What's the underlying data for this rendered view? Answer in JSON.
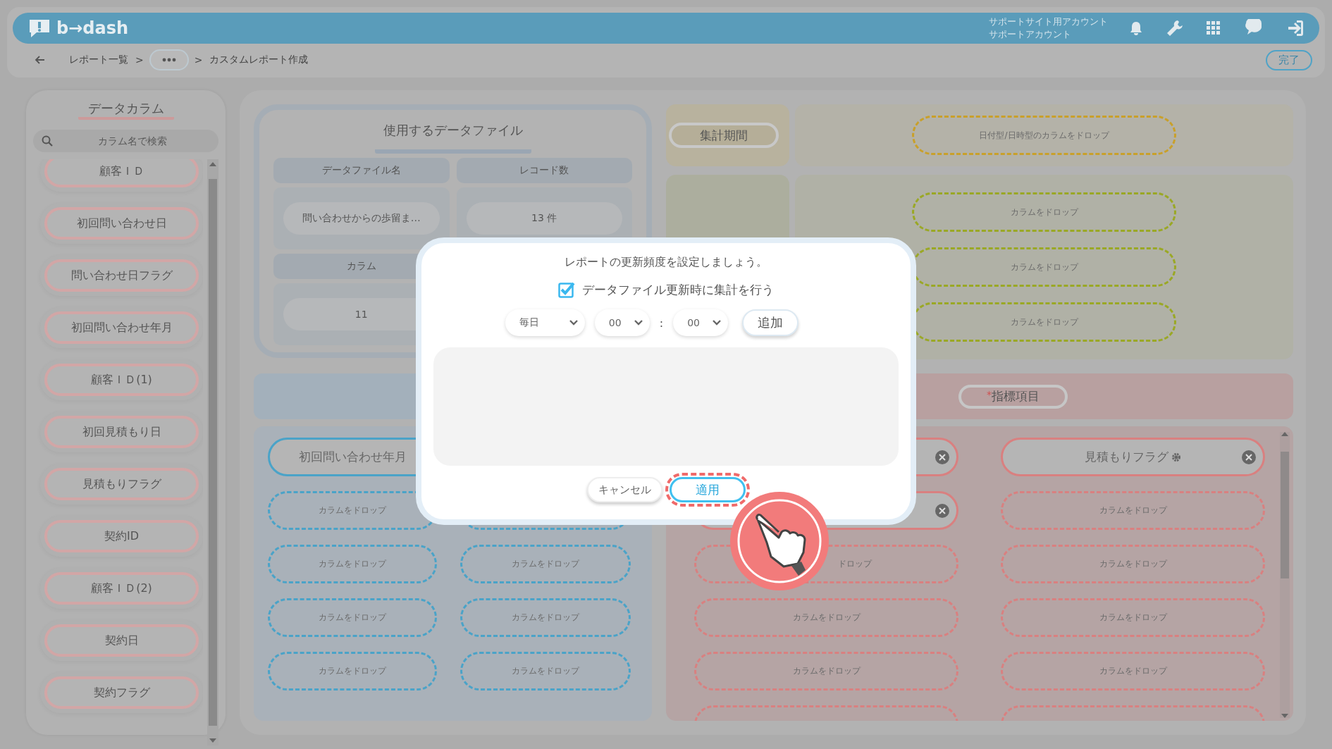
{
  "header": {
    "logo": "b→dash",
    "account_lines": [
      "サポートサイト用アカウント",
      "サポートアカウント"
    ]
  },
  "breadcrumb": [
    {
      "kind": "link",
      "label": "レポート一覧"
    },
    {
      "kind": "separator",
      "label": ">"
    },
    {
      "kind": "more"
    },
    {
      "kind": "separator",
      "label": ">"
    },
    {
      "kind": "current",
      "label": "カスタムレポート作成"
    }
  ],
  "done_button": "完了",
  "sidebar": {
    "title": "データカラム",
    "search": {
      "placeholder": "カラム名で検索"
    },
    "columns": [
      "顧客ＩＤ",
      "初回問い合わせ日",
      "問い合わせ日フラグ",
      "初回問い合わせ年月",
      "顧客ＩＤ(1)",
      "初回見積もり日",
      "見積もりフラグ",
      "契約ID",
      "顧客ＩＤ(2)",
      "契約日",
      "契約フラグ"
    ]
  },
  "data_file": {
    "title": "使用するデータファイル",
    "headers": [
      "データファイル名",
      "レコード数"
    ],
    "values": [
      "問い合わせからの歩留ま…",
      "13 件"
    ],
    "column_header": "カラム",
    "column_value": "11"
  },
  "period": {
    "label": "集計期間",
    "drop": "日付型/日時型のカラムをドロップ"
  },
  "group_drops": [
    "カラムをドロップ",
    "カラムをドロップ",
    "カラムをドロップ"
  ],
  "axis_panel": {
    "chips": [
      {
        "kind": "filled",
        "label": "初回問い合わせ年月"
      },
      {
        "kind": "drop",
        "label": "カラムをドロップ"
      },
      {
        "kind": "drop"
      },
      {
        "kind": "drop",
        "label": "カラムをドロップ"
      },
      {
        "kind": "drop",
        "label": "カラムをドロップ"
      },
      {
        "kind": "drop",
        "label": "カラムをドロップ"
      },
      {
        "kind": "drop",
        "label": "カラムをドロップ"
      },
      {
        "kind": "drop",
        "label": "カラムをドロップ"
      },
      {
        "kind": "drop",
        "label": "カラムをドロップ"
      }
    ]
  },
  "metric_panel": {
    "title": "指標項目",
    "required_mark": "*",
    "chips": [
      {
        "kind": "filled",
        "removable": true,
        "settings": false
      },
      {
        "kind": "filled",
        "label": "見積もりフラグ",
        "removable": true,
        "settings": true
      },
      {
        "kind": "filled",
        "removable": true,
        "settings": false
      },
      {
        "kind": "drop",
        "label": "カラムをドロップ"
      },
      {
        "kind": "drop",
        "label": "ドロップ"
      },
      {
        "kind": "drop",
        "label": "カラムをドロップ"
      },
      {
        "kind": "drop",
        "label": "カラムをドロップ"
      },
      {
        "kind": "drop",
        "label": "カラムをドロップ"
      },
      {
        "kind": "drop",
        "label": "カラムをドロップ"
      },
      {
        "kind": "drop",
        "label": "カラムをドロップ"
      },
      {
        "kind": "drop"
      },
      {
        "kind": "drop"
      }
    ]
  },
  "modal": {
    "title": "レポートの更新頻度を設定しましょう。",
    "checkbox": {
      "label": "データファイル更新時に集計を行う",
      "checked": true
    },
    "frequency": "毎日",
    "hour": "00",
    "time_separator": ":",
    "minute": "00",
    "add_button": "追加",
    "cancel_button": "キャンセル",
    "apply_button": {
      "label": "適用",
      "highlighted": true
    }
  }
}
